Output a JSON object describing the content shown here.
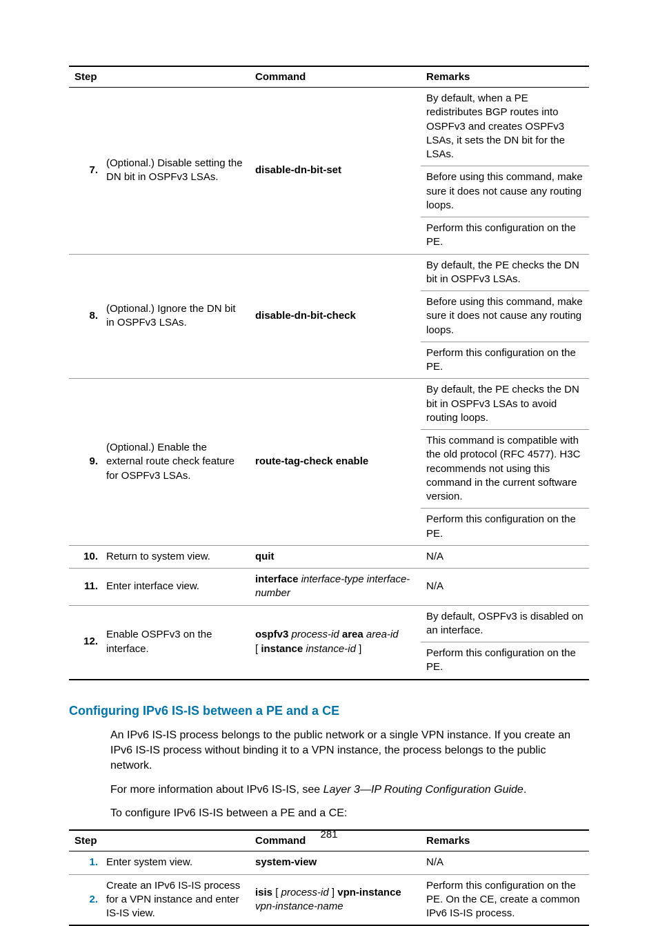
{
  "table1": {
    "headers": [
      "Step",
      "Command",
      "Remarks"
    ],
    "rows": [
      {
        "num": "7.",
        "desc": "(Optional.) Disable setting the DN bit in OSPFv3 LSAs.",
        "cmd_bold": "disable-dn-bit-set",
        "remarks": [
          "By default, when a PE redistributes BGP routes into OSPFv3 and creates OSPFv3 LSAs, it sets the DN bit for the LSAs.",
          "Before using this command, make sure it does not cause any routing loops.",
          "Perform this configuration on the PE."
        ]
      },
      {
        "num": "8.",
        "desc": "(Optional.) Ignore the DN bit in OSPFv3 LSAs.",
        "cmd_bold": "disable-dn-bit-check",
        "remarks": [
          "By default, the PE checks the DN bit in OSPFv3 LSAs.",
          "Before using this command, make sure it does not cause any routing loops.",
          "Perform this configuration on the PE."
        ]
      },
      {
        "num": "9.",
        "desc": "(Optional.) Enable the external route check feature for OSPFv3 LSAs.",
        "cmd_bold": "route-tag-check enable",
        "remarks": [
          "By default, the PE checks the DN bit in OSPFv3 LSAs to avoid routing loops.",
          "This command is compatible with the old protocol (RFC 4577). H3C recommends not using this command in the current software version.",
          "Perform this configuration on the PE."
        ]
      },
      {
        "num": "10.",
        "desc": "Return to system view.",
        "cmd_bold": "quit",
        "remarks_single": "N/A"
      },
      {
        "num": "11.",
        "desc": "Enter interface view.",
        "cmd_parts": [
          {
            "t": "interface ",
            "b": true
          },
          {
            "t": "interface-type interface-number",
            "i": true
          }
        ],
        "remarks_single": "N/A"
      },
      {
        "num": "12.",
        "desc": "Enable OSPFv3 on the interface.",
        "cmd_parts": [
          {
            "t": "ospfv3 ",
            "b": true
          },
          {
            "t": "process-id ",
            "i": true
          },
          {
            "t": "area ",
            "b": true
          },
          {
            "t": "area-id ",
            "i": true
          },
          {
            "t": "[ ",
            "b": false
          },
          {
            "t": "instance ",
            "b": true
          },
          {
            "t": "instance-id ",
            "i": true
          },
          {
            "t": "]",
            "b": false
          }
        ],
        "remarks": [
          "By default, OSPFv3 is disabled on an interface.",
          "Perform this configuration on the PE."
        ]
      }
    ]
  },
  "section_heading": "Configuring IPv6 IS-IS between a PE and a CE",
  "para1": "An IPv6 IS-IS process belongs to the public network or a single VPN instance. If you create an IPv6 IS-IS process without binding it to a VPN instance, the process belongs to the public network.",
  "para2_pre": "For more information about IPv6 IS-IS, see ",
  "para2_italic": "Layer 3—IP Routing Configuration Guide",
  "para2_post": ".",
  "para3": "To configure IPv6 IS-IS between a PE and a CE:",
  "table2": {
    "headers": [
      "Step",
      "Command",
      "Remarks"
    ],
    "rows": [
      {
        "num": "1.",
        "desc": "Enter system view.",
        "cmd_bold": "system-view",
        "remarks_single": "N/A"
      },
      {
        "num": "2.",
        "desc": "Create an IPv6 IS-IS process for a VPN instance and enter IS-IS view.",
        "cmd_parts": [
          {
            "t": "isis ",
            "b": true
          },
          {
            "t": "[ ",
            "b": false
          },
          {
            "t": "process-id ",
            "i": true
          },
          {
            "t": "] ",
            "b": false
          },
          {
            "t": "vpn-instance ",
            "b": true
          },
          {
            "t": "vpn-instance-name",
            "i": true
          }
        ],
        "remarks_single": "Perform this configuration on the PE. On the CE, create a common IPv6 IS-IS process."
      }
    ]
  },
  "pagenum": "281"
}
